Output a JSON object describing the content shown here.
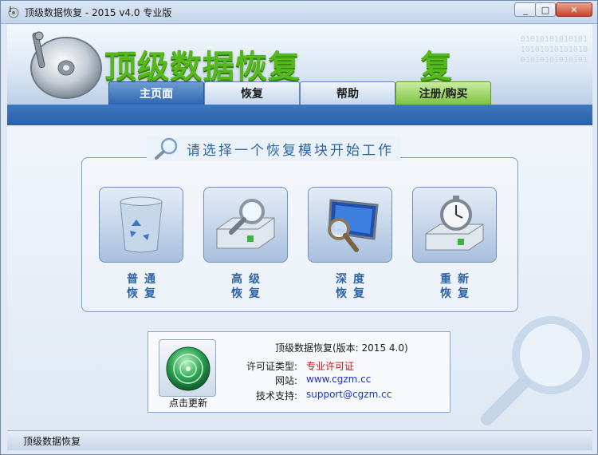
{
  "window": {
    "title": "顶级数据恢复 - 2015 v4.0 专业版",
    "controls": {
      "minimize": "_",
      "maximize": "□",
      "close": "✕"
    }
  },
  "header": {
    "brand": "顶级数据恢复",
    "brand_fragment": "复",
    "binary_lines": [
      "01010101010101",
      "10101010101010",
      "01010101010101"
    ]
  },
  "tabs": [
    {
      "label": "主页面",
      "active": true
    },
    {
      "label": "恢复",
      "active": false
    },
    {
      "label": "帮助",
      "active": false
    },
    {
      "label": "注册/购买",
      "active": false,
      "accent": "#7ec441"
    }
  ],
  "main": {
    "heading": "请选择一个恢复模块开始工作",
    "modules": [
      {
        "line1": "普通",
        "line2": "恢复",
        "icon": "recycle-bin-icon"
      },
      {
        "line1": "高级",
        "line2": "恢复",
        "icon": "drive-magnifier-icon"
      },
      {
        "line1": "深度",
        "line2": "恢复",
        "icon": "monitor-magnifier-icon"
      },
      {
        "line1": "重新",
        "line2": "恢复",
        "icon": "drive-stopwatch-icon"
      }
    ]
  },
  "info": {
    "title": "顶级数据恢复(版本: 2015 4.0)",
    "update_label": "点击更新",
    "license_label": "许可证类型:",
    "license_value": "专业许可证",
    "site_label": "网站:",
    "site_value": "www.cgzm.cc",
    "support_label": "技术支持:",
    "support_value": "support@cgzm.cc"
  },
  "statusbar": {
    "text": "顶级数据恢复"
  },
  "colors": {
    "accent_blue": "#2e65aa",
    "brand_green": "#55b81b",
    "license_red": "#cc1111",
    "link_blue": "#1a33cc"
  }
}
